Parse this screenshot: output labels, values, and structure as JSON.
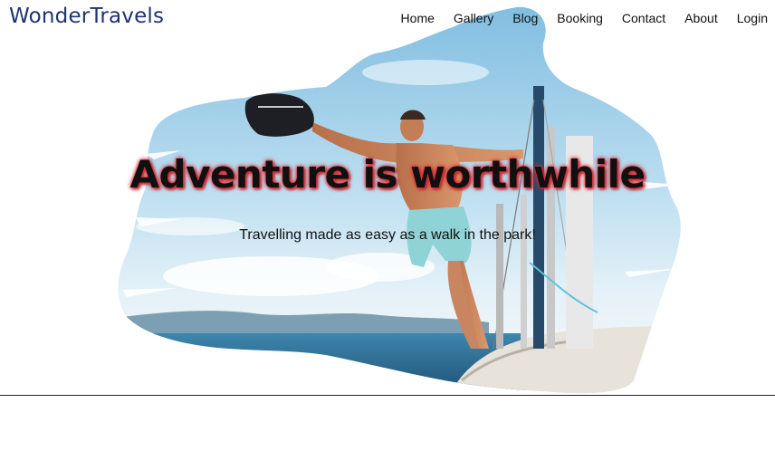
{
  "brand": {
    "name": "WonderTravels"
  },
  "nav": {
    "items": [
      {
        "label": "Home"
      },
      {
        "label": "Gallery"
      },
      {
        "label": "Blog"
      },
      {
        "label": "Booking"
      },
      {
        "label": "Contact"
      },
      {
        "label": "About"
      },
      {
        "label": "Login"
      }
    ]
  },
  "hero": {
    "title": "Adventure is worthwhile",
    "subtitle": "Travelling made as easy as a walk in the park!",
    "image_description_icon": "man-on-sailboat-photo",
    "colors": {
      "sky": "#a9d2ea",
      "sea": "#2c6d93",
      "title_glow": "#e0303a",
      "brand": "#1f3470"
    }
  }
}
